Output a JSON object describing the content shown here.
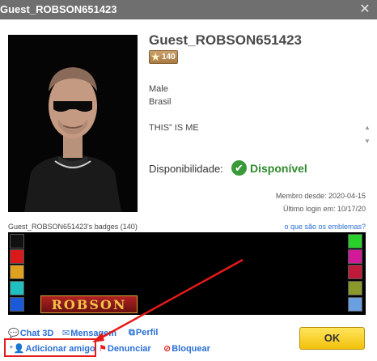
{
  "window": {
    "title": "Guest_ROBSON651423"
  },
  "profile": {
    "username": "Guest_ROBSON651423",
    "level": "140",
    "gender": "Male",
    "country": "Brasil",
    "tagline": "THIS” IS ME",
    "availability_label": "Disponibilidade:",
    "availability_status": "Disponível",
    "member_since": "Membro desde: 2020-04-15",
    "last_login": "Último login em: 10/17/20"
  },
  "badges": {
    "title": "Guest_ROBSON651423's badges (140)",
    "emblems_link": "o que são os emblemas?",
    "name_badge_text": "ROBSON",
    "left_colors": [
      "#111111",
      "#d81a1a",
      "#e0a020",
      "#20c0c0",
      "#1a5ad8"
    ],
    "right_colors": [
      "#2ad02a",
      "#d01a9a",
      "#c01a3a",
      "#8a9a2a",
      "#6aa0e0"
    ]
  },
  "actions": {
    "chat": "Chat 3D",
    "message": "Mensagem",
    "profile": "Perfil",
    "add_friend": "Adicionar amigo",
    "report": "Denunciar",
    "block": "Bloquear"
  },
  "buttons": {
    "ok": "OK"
  },
  "colors": {
    "accent_link": "#2a6fd6",
    "available_green": "#2f8a2f",
    "ok_yellow": "#f5c518",
    "highlight_red": "#e51a1a"
  }
}
